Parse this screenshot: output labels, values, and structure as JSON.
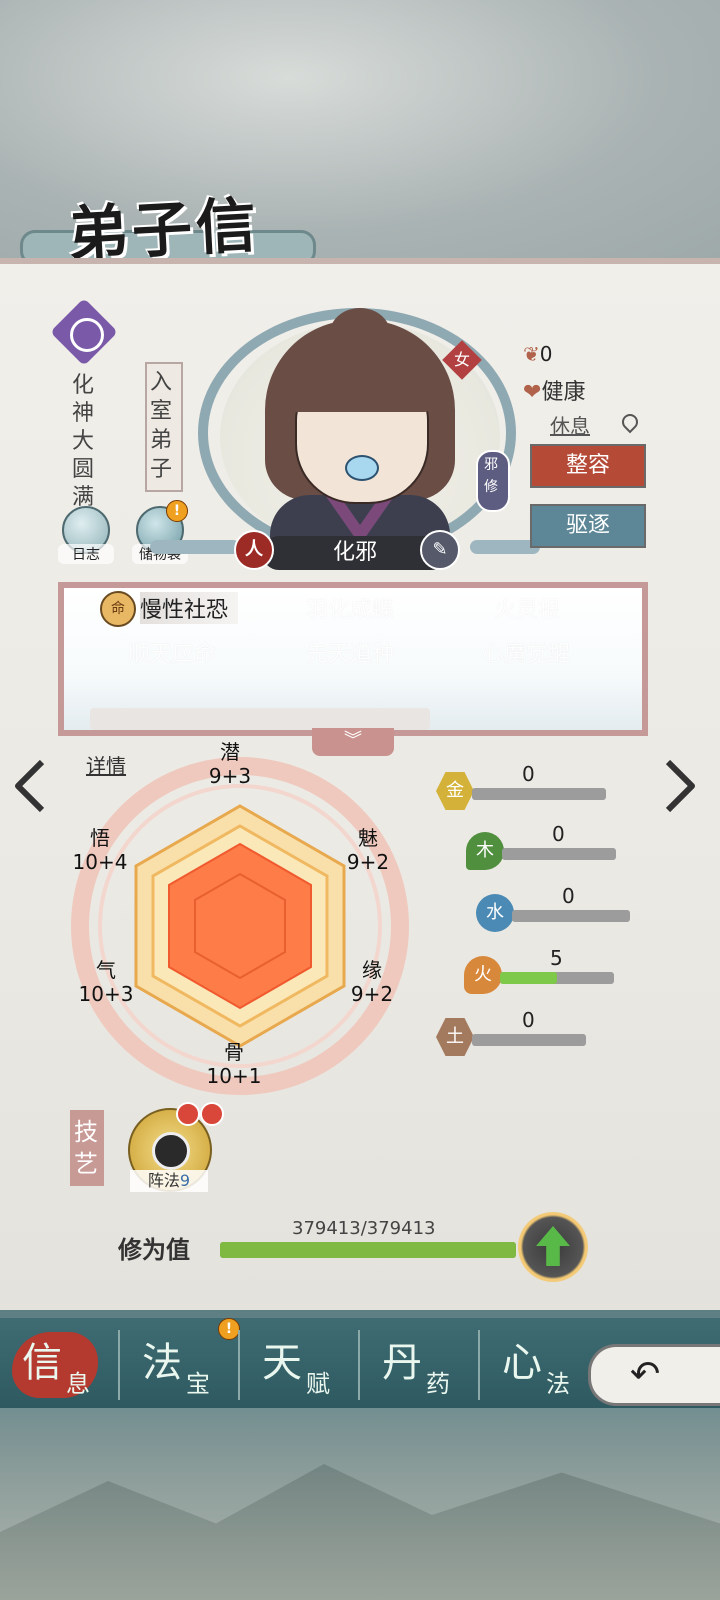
{
  "header": {
    "title": "弟子信息"
  },
  "profile": {
    "realm": "化神大圆满",
    "rank": "入室弟子",
    "name": "化邪",
    "gender": "女",
    "alignment": "邪修",
    "name_left_badge": "人",
    "reputation": "0",
    "health": "健康",
    "status": "休息"
  },
  "buttons": {
    "log": "日志",
    "bag": "储物袋",
    "makeover": "整容",
    "expel": "驱逐",
    "details": "详情",
    "expand": "︾"
  },
  "traits": {
    "badge": "命",
    "items": [
      "慢性社恐",
      "羽化成蝶",
      "火灵根",
      "顺天应命",
      "先天道种",
      "心魔觉醒"
    ]
  },
  "attributes": {
    "potential": {
      "label": "潜",
      "value": "9+3"
    },
    "charm": {
      "label": "魅",
      "value": "9+2"
    },
    "fate": {
      "label": "缘",
      "value": "9+2"
    },
    "bone": {
      "label": "骨",
      "value": "10+1"
    },
    "qi": {
      "label": "气",
      "value": "10+3"
    },
    "insight": {
      "label": "悟",
      "value": "10+4"
    }
  },
  "elements": [
    {
      "name": "金",
      "value": "0",
      "level": 0,
      "color": "#d4b23a"
    },
    {
      "name": "木",
      "value": "0",
      "level": 0,
      "color": "#4f8f3e"
    },
    {
      "name": "水",
      "value": "0",
      "level": 0,
      "color": "#4a8ab4"
    },
    {
      "name": "火",
      "value": "5",
      "level": 0.5,
      "color": "#d8883a"
    },
    {
      "name": "土",
      "value": "0",
      "level": 0,
      "color": "#a37a5e"
    }
  ],
  "skills": {
    "label": "技艺",
    "items": [
      {
        "name": "阵法",
        "level": "9"
      }
    ]
  },
  "cultivation": {
    "label": "修为值",
    "value": "379413/379413",
    "progress": 1.0
  },
  "tabs": [
    {
      "big": "信",
      "small": "息"
    },
    {
      "big": "法",
      "small": "宝"
    },
    {
      "big": "天",
      "small": "赋"
    },
    {
      "big": "丹",
      "small": "药"
    },
    {
      "big": "心",
      "small": "法"
    }
  ],
  "colors": {
    "accent_red": "#b54a36",
    "accent_teal": "#5d8796",
    "tab_bg": "#2e5960",
    "progress_green": "#7fb941"
  }
}
